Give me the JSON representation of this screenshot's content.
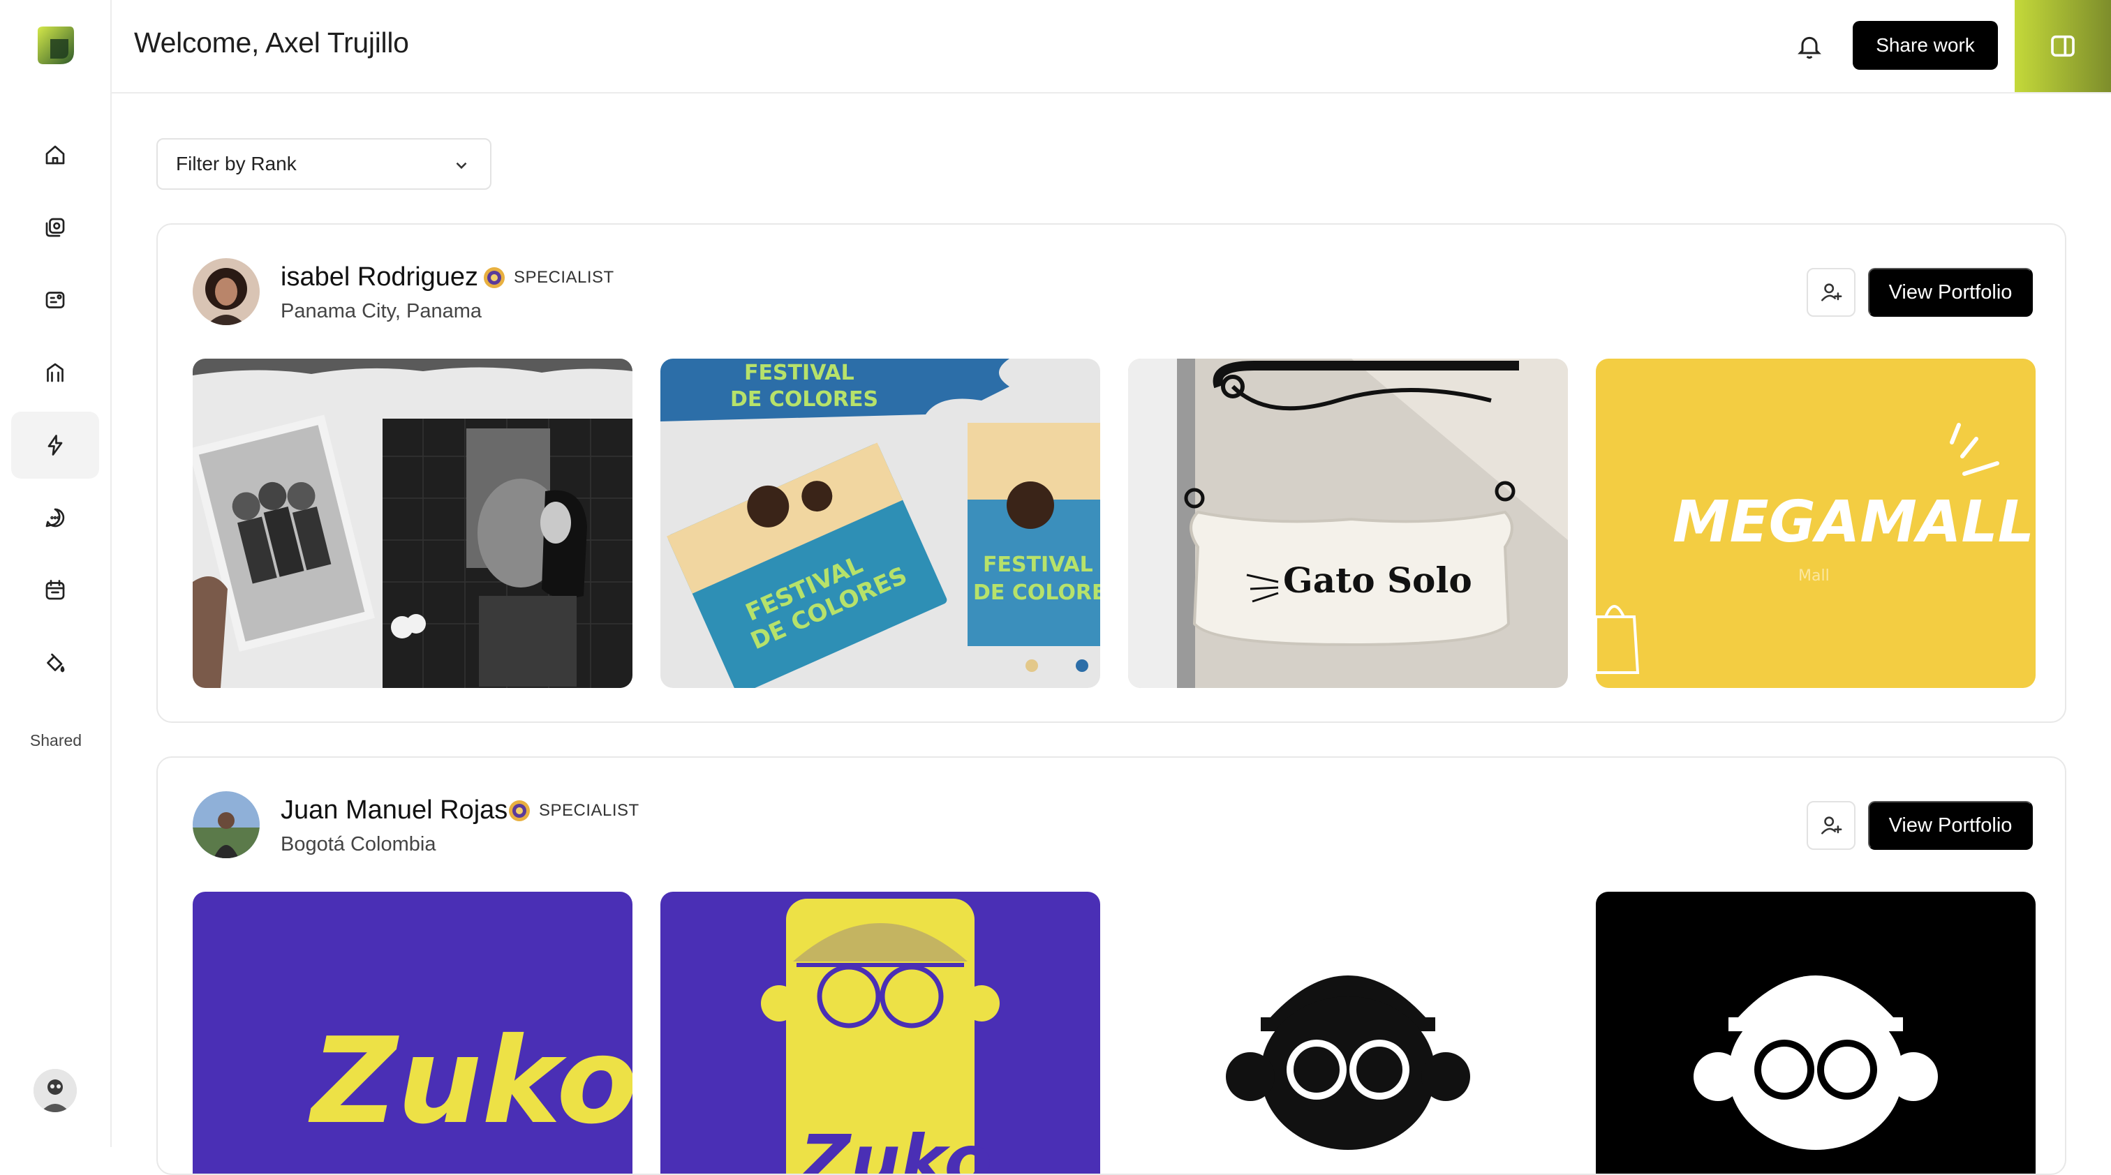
{
  "header": {
    "welcome": "Welcome, Axel Trujillo",
    "share_label": "Share work"
  },
  "sidebar": {
    "items": [
      {
        "icon": "home-icon"
      },
      {
        "icon": "gallery-icon"
      },
      {
        "icon": "profile-card-icon"
      },
      {
        "icon": "academy-icon"
      },
      {
        "icon": "lightning-icon",
        "active": true
      },
      {
        "icon": "chat-icon"
      },
      {
        "icon": "calendar-icon"
      },
      {
        "icon": "paint-bucket-icon"
      }
    ],
    "shared_label": "Shared"
  },
  "filter": {
    "label": "Filter by Rank"
  },
  "creators": [
    {
      "name": "isabel Rodriguez",
      "rank": "SPECIALIST",
      "location": "Panama City, Panama",
      "view_label": "View Portfolio",
      "works": [
        {
          "caption": ""
        },
        {
          "caption": "FESTIVAL DE COLORES"
        },
        {
          "caption": "Gato Solo"
        },
        {
          "caption": "MEGAMALL",
          "subcaption": "Mall"
        }
      ]
    },
    {
      "name": "Juan Manuel Rojas",
      "rank": "SPECIALIST",
      "location": "Bogotá Colombia",
      "view_label": "View Portfolio",
      "works": [
        {
          "caption": "Zuko"
        },
        {
          "caption": "Zuko"
        },
        {
          "caption": ""
        },
        {
          "caption": ""
        }
      ]
    }
  ],
  "colors": {
    "accent_gradient_start": "#c4d93a",
    "accent_gradient_end": "#7d8d2b",
    "megamall_yellow": "#f3cd42",
    "zuko_purple": "#4a2fb5",
    "zuko_yellow": "#ede146"
  }
}
